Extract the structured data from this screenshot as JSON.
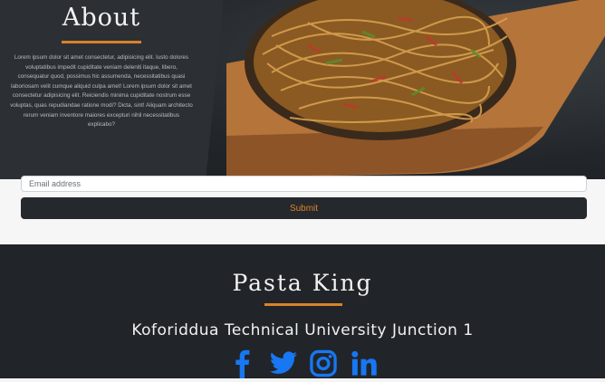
{
  "about": {
    "title": "About",
    "body": "Lorem ipsum dolor sit amet consectetur, adipisicing elit. Iusto dolores voluptatibus impedit cupiditate veniam deleniti itaque, libero, consequatur quod, possimus hic assumenda, necessitatibus quasi laboriosam velit cumque aliquid culpa amet! Lorem ipsum dolor sit amet consectetur adipisicing elit. Reiciendis minima cupiditate nostrum esse voluptas, quas repudiandae ratione modi? Dicta, sint! Aliquam architecto rerum veniam inventore maiores excepturi nihil necessitatibus explicabo?",
    "image_alt": "plate of stir-fried noodles"
  },
  "form": {
    "email_placeholder": "Email address",
    "submit_label": "Submit"
  },
  "footer": {
    "brand": "Pasta King",
    "address": "Koforiddua Technical University Junction 1",
    "socials": [
      {
        "icon": "facebook-icon"
      },
      {
        "icon": "twitter-icon"
      },
      {
        "icon": "instagram-icon"
      },
      {
        "icon": "linkedin-icon"
      }
    ]
  },
  "colors": {
    "accent": "#d9832a",
    "social_blue": "#1877f2",
    "dark": "#212529"
  }
}
